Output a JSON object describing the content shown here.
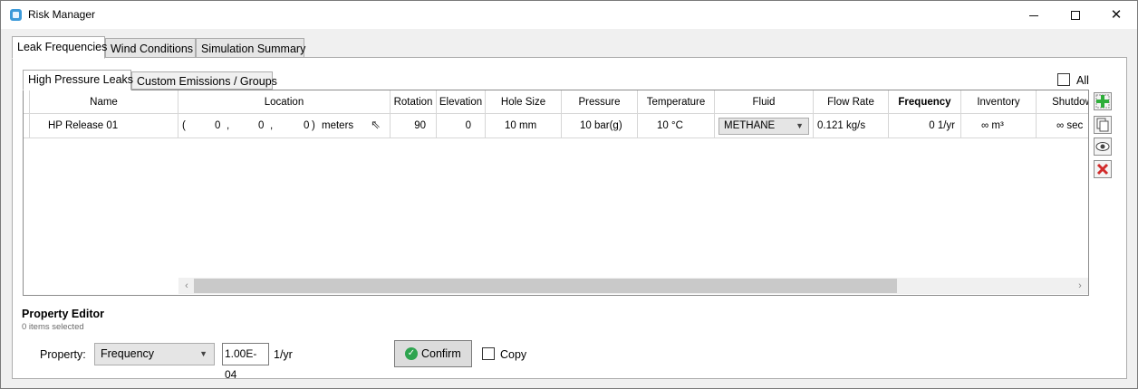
{
  "window": {
    "title": "Risk Manager",
    "minimize": "",
    "maximize": "",
    "close": "✕"
  },
  "outer_tabs": [
    "Leak Frequencies",
    "Wind Conditions",
    "Simulation Summary"
  ],
  "inner_tabs": [
    "High Pressure Leaks",
    "Custom Emissions / Groups"
  ],
  "all_label": "All",
  "columns": [
    "Name",
    "Location",
    "Rotation",
    "Elevation",
    "Hole Size",
    "Pressure",
    "Temperature",
    "Fluid",
    "Flow Rate",
    "Frequency",
    "Inventory",
    "Shutdow"
  ],
  "row": {
    "name": "HP Release 01",
    "location": {
      "open": "(",
      "x": "0",
      "sep1": ",",
      "y": "0",
      "sep2": ",",
      "z": "0",
      "close": ")",
      "unit": "meters"
    },
    "rotation": "90",
    "elevation": "0",
    "hole_size": "10  mm",
    "pressure": "10  bar(g)",
    "temperature": "10  °C",
    "fluid": "METHANE",
    "flow_rate": "0.121  kg/s",
    "frequency": "0  1/yr",
    "inventory": "∞  m³",
    "shutdown": "∞  sec"
  },
  "side_buttons": [
    "add-icon",
    "copy-icon",
    "eye-icon",
    "delete-icon"
  ],
  "property_editor": {
    "title": "Property Editor",
    "selection": "0 items selected",
    "property_label": "Property:",
    "property_value": "Frequency",
    "value": "1.00E-04",
    "unit": "1/yr",
    "confirm": "Confirm",
    "copy": "Copy"
  },
  "colors": {
    "accent_green": "#2ea44f",
    "delete_red": "#d12b2b",
    "add_green": "#2fae3b"
  }
}
